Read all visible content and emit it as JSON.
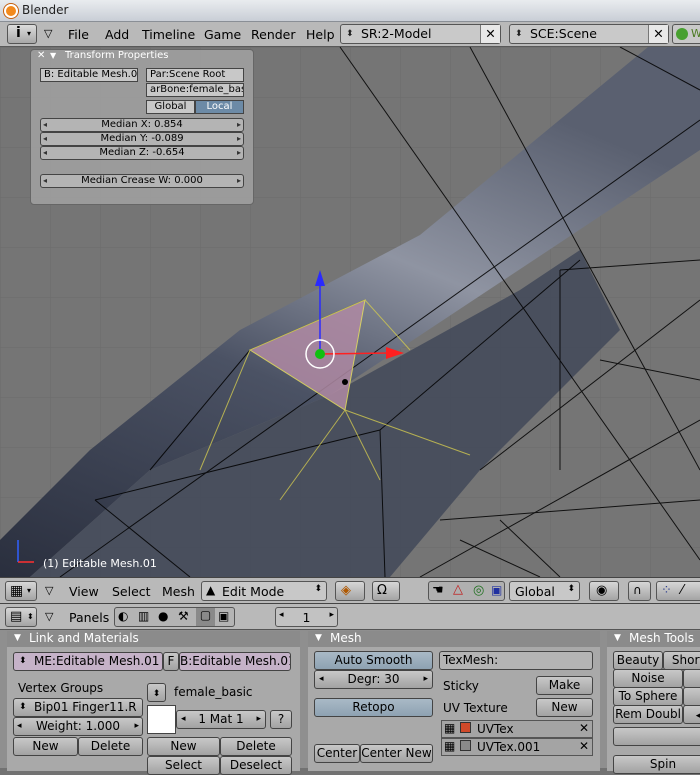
{
  "window": {
    "title": "Blender"
  },
  "menubar": {
    "menus": [
      "File",
      "Add",
      "Timeline",
      "Game",
      "Render",
      "Help"
    ],
    "screen_field": "SR:2-Model",
    "scene_field": "SCE:Scene",
    "extra": "W"
  },
  "transform_panel": {
    "title": "Transform Properties",
    "object_name": "B: Editable Mesh.01",
    "parent": "Par:Scene Root",
    "parent_bone": "arBone:female_basic",
    "global_label": "Global",
    "local_label": "Local",
    "median_x": "Median X: 0.854",
    "median_y": "Median Y: -0.089",
    "median_z": "Median Z: -0.654",
    "median_crease": "Median Crease W: 0.000"
  },
  "viewport": {
    "object_label": "(1) Editable Mesh.01"
  },
  "header3d": {
    "menus": [
      "View",
      "Select",
      "Mesh"
    ],
    "mode": "Edit Mode",
    "orientation": "Global"
  },
  "buttons_window": {
    "panels_label": "Panels",
    "frame": "1",
    "link_materials": {
      "title": "Link and Materials",
      "mesh_name": "ME:Editable Mesh.01",
      "f_label": "F",
      "object_name": "B:Editable Mesh.01",
      "vertex_groups_label": "Vertex Groups",
      "vertex_group": "Bip01 Finger11.R",
      "weight": "Weight: 1.000",
      "new_label": "New",
      "delete_label": "Delete",
      "material_name": "female_basic",
      "mat_index": "1 Mat 1",
      "help_label": "?",
      "new2_label": "New",
      "delete2_label": "Delete",
      "select_label": "Select",
      "deselect_label": "Deselect"
    },
    "mesh": {
      "title": "Mesh",
      "auto_smooth": "Auto Smooth",
      "degr": "Degr: 30",
      "retopo": "Retopo",
      "center": "Center",
      "center_new": "Center New",
      "texmesh_label": "TexMesh:",
      "sticky_label": "Sticky",
      "make_label": "Make",
      "uv_texture_label": "UV Texture",
      "new_label": "New",
      "uvtex_items": [
        "UVTex",
        "UVTex.001"
      ]
    },
    "mesh_tools": {
      "title": "Mesh Tools",
      "beauty": "Beauty",
      "short": "Short",
      "noise": "Noise",
      "to_sphere": "To Sphere",
      "rem_doubl": "Rem Doubl",
      "spin": "Spin"
    }
  }
}
